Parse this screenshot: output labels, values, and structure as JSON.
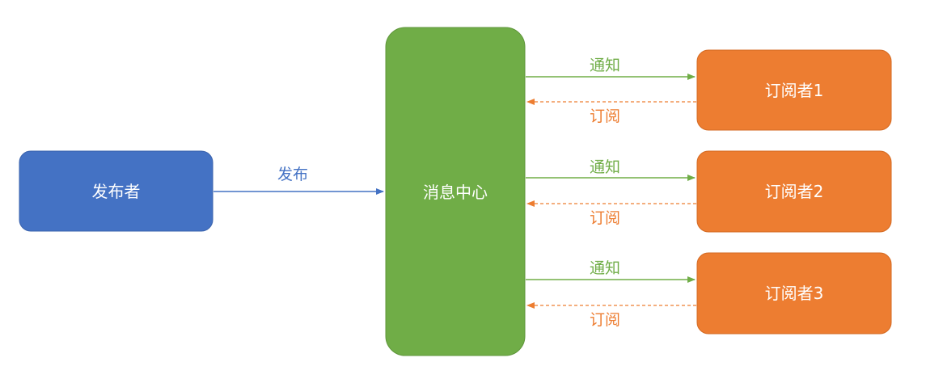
{
  "colors": {
    "publisher": "#4472c4",
    "center": "#70ad47",
    "subscriber": "#ed7d31",
    "node_text": "#ffffff"
  },
  "nodes": {
    "publisher": "发布者",
    "center": "消息中心",
    "subscribers": [
      "订阅者1",
      "订阅者2",
      "订阅者3"
    ]
  },
  "edges": {
    "publish": "发布",
    "notify": "通知",
    "subscribe": "订阅"
  }
}
